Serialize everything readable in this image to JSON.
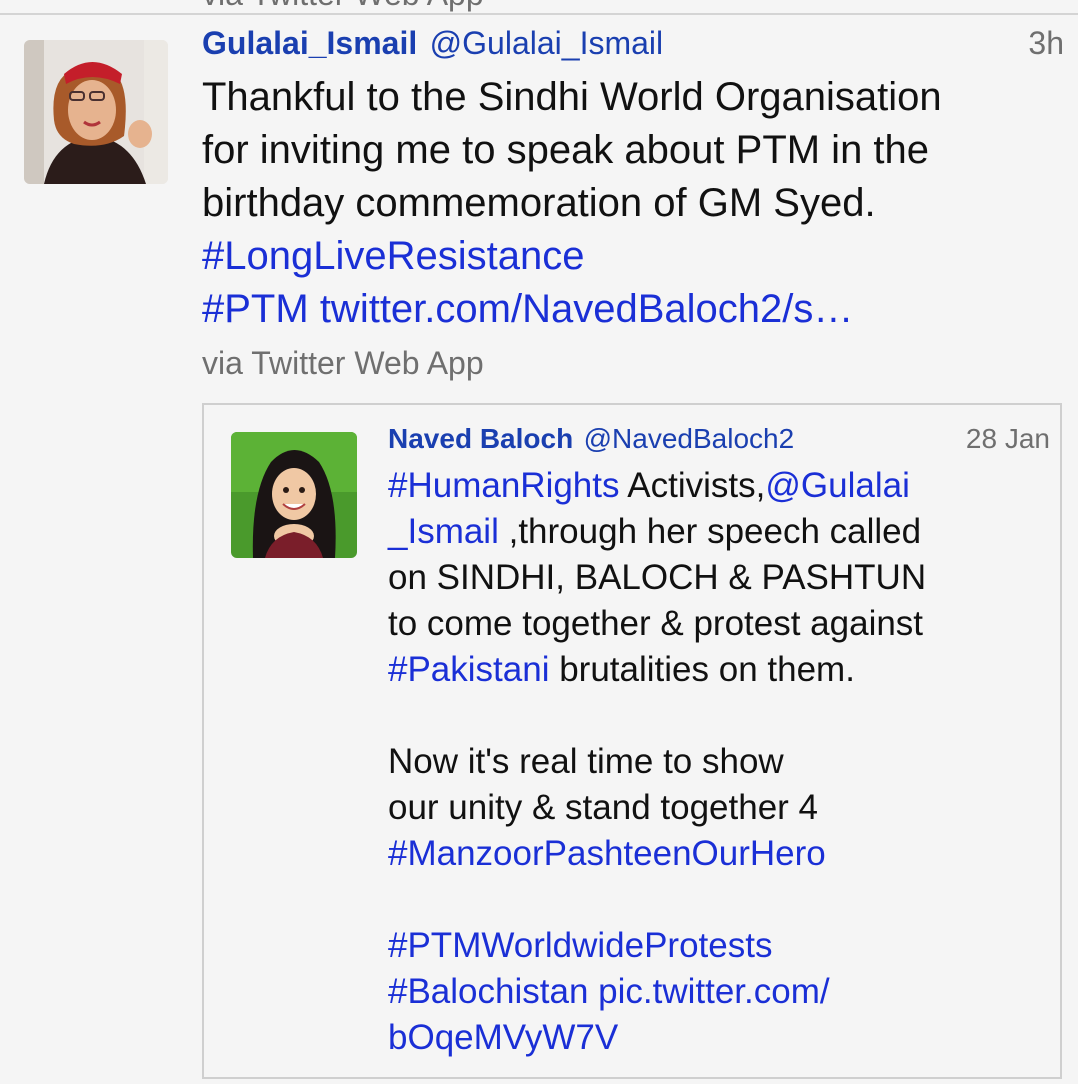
{
  "previous_tweet": {
    "source": "via Twitter Web App"
  },
  "tweet": {
    "author_name": "Gulalai_Ismail",
    "author_handle": "@Gulalai_Ismail",
    "timestamp": "3h",
    "text_lines": [
      "Thankful to the Sindhi World Organisation",
      "for inviting me to speak about PTM in the",
      "birthday commemoration of GM Syed."
    ],
    "hashtag_1": "#LongLiveResistance",
    "hashtag_2": "#PTM",
    "link": "twitter.com/NavedBaloch2/s…",
    "source": "via Twitter Web App"
  },
  "quoted_tweet": {
    "author_name": "Naved Baloch",
    "author_handle": "@NavedBaloch2",
    "timestamp": "28 Jan",
    "hashtag_human_rights": "#HumanRights",
    "text_activists": " Activists,",
    "mention_part_1": "@Gulalai",
    "mention_part_2": "_Ismail",
    "text_through": " ,through her speech called",
    "text_line_3": "on SINDHI, BALOCH & PASHTUN",
    "text_line_4": "to come together & protest against",
    "hashtag_pakistani": "#Pakistani",
    "text_brutalities": " brutalities on them.",
    "text_line_7": "Now it's real time to show",
    "text_line_8": "our unity & stand together 4",
    "hashtag_manzoor": "#ManzoorPashteenOurHero",
    "hashtag_ptm_worldwide": "#PTMWorldwideProtests",
    "hashtag_balochistan": "#Balochistan",
    "pic_link_part_1": " pic.twitter.com/",
    "pic_link_part_2": "bOqeMVyW7V"
  },
  "colors": {
    "link": "#1a2fd6",
    "author": "#1a3fb0",
    "meta": "#6f6f6f",
    "background": "#f5f5f5"
  }
}
